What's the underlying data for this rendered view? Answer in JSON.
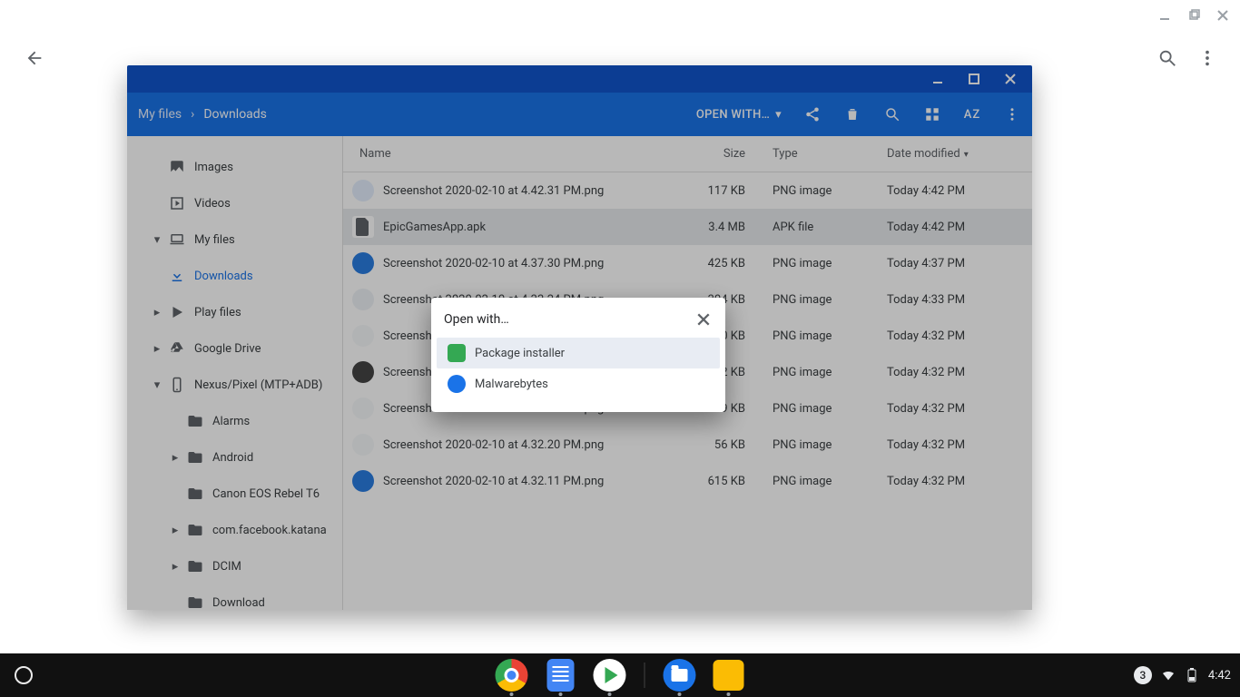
{
  "open_with_label": "OPEN WITH…",
  "breadcrumbs": [
    "My files",
    "Downloads"
  ],
  "columns": {
    "name": "Name",
    "size": "Size",
    "type": "Type",
    "date": "Date modified"
  },
  "sidebar": [
    {
      "label": "Images",
      "icon": "image",
      "depth": 1
    },
    {
      "label": "Videos",
      "icon": "video",
      "depth": 1
    },
    {
      "label": "My files",
      "icon": "laptop",
      "depth": 0,
      "expand": "down"
    },
    {
      "label": "Downloads",
      "icon": "download",
      "depth": 1,
      "selected": true
    },
    {
      "label": "Play files",
      "icon": "play",
      "depth": 1,
      "expand": "right"
    },
    {
      "label": "Google Drive",
      "icon": "drive",
      "depth": 0,
      "expand": "right"
    },
    {
      "label": "Nexus/Pixel (MTP+ADB)",
      "icon": "phone",
      "depth": 0,
      "expand": "down"
    },
    {
      "label": "Alarms",
      "icon": "folder",
      "depth": 2
    },
    {
      "label": "Android",
      "icon": "folder",
      "depth": 2,
      "expand": "right"
    },
    {
      "label": "Canon EOS Rebel T6",
      "icon": "folder",
      "depth": 2
    },
    {
      "label": "com.facebook.katana",
      "icon": "folder",
      "depth": 2,
      "expand": "right"
    },
    {
      "label": "DCIM",
      "icon": "folder",
      "depth": 2,
      "expand": "right"
    },
    {
      "label": "Download",
      "icon": "folder",
      "depth": 2
    }
  ],
  "files": [
    {
      "name": "Screenshot 2020-02-10 at 4.42.31 PM.png",
      "size": "117 KB",
      "type": "PNG image",
      "date": "Today 4:42 PM",
      "thumb": "#e3eefc"
    },
    {
      "name": "EpicGamesApp.apk",
      "size": "3.4 MB",
      "type": "APK file",
      "date": "Today 4:42 PM",
      "thumb": "apk",
      "selected": true
    },
    {
      "name": "Screenshot 2020-02-10 at 4.37.30 PM.png",
      "size": "425 KB",
      "type": "PNG image",
      "date": "Today 4:37 PM",
      "thumb": "#2a7de1"
    },
    {
      "name": "Screenshot 2020-02-10 at 4.33.24 PM.png",
      "size": "304 KB",
      "type": "PNG image",
      "date": "Today 4:33 PM",
      "thumb": "#eef2f6"
    },
    {
      "name": "Screenshot 2020-02-10 at 4.32.38 PM.png",
      "size": "70 KB",
      "type": "PNG image",
      "date": "Today 4:32 PM",
      "thumb": "#f6f8fa"
    },
    {
      "name": "Screenshot 2020-02-10 at 4.32.31 PM.png",
      "size": "82 KB",
      "type": "PNG image",
      "date": "Today 4:32 PM",
      "thumb": "#444"
    },
    {
      "name": "Screenshot 2020-02-10 at 4.32.27 PM.png",
      "size": "69 KB",
      "type": "PNG image",
      "date": "Today 4:32 PM",
      "thumb": "#f6f8fa"
    },
    {
      "name": "Screenshot 2020-02-10 at 4.32.20 PM.png",
      "size": "56 KB",
      "type": "PNG image",
      "date": "Today 4:32 PM",
      "thumb": "#f6f8fa"
    },
    {
      "name": "Screenshot 2020-02-10 at 4.32.11 PM.png",
      "size": "615 KB",
      "type": "PNG image",
      "date": "Today 4:32 PM",
      "thumb": "#2a7de1"
    }
  ],
  "dialog": {
    "title": "Open with…",
    "items": [
      {
        "label": "Package installer",
        "icon_bg": "#34a853",
        "selected": true
      },
      {
        "label": "Malwarebytes",
        "icon_bg": "#1a73e8"
      }
    ]
  },
  "status": {
    "count": "3",
    "time": "4:42"
  }
}
